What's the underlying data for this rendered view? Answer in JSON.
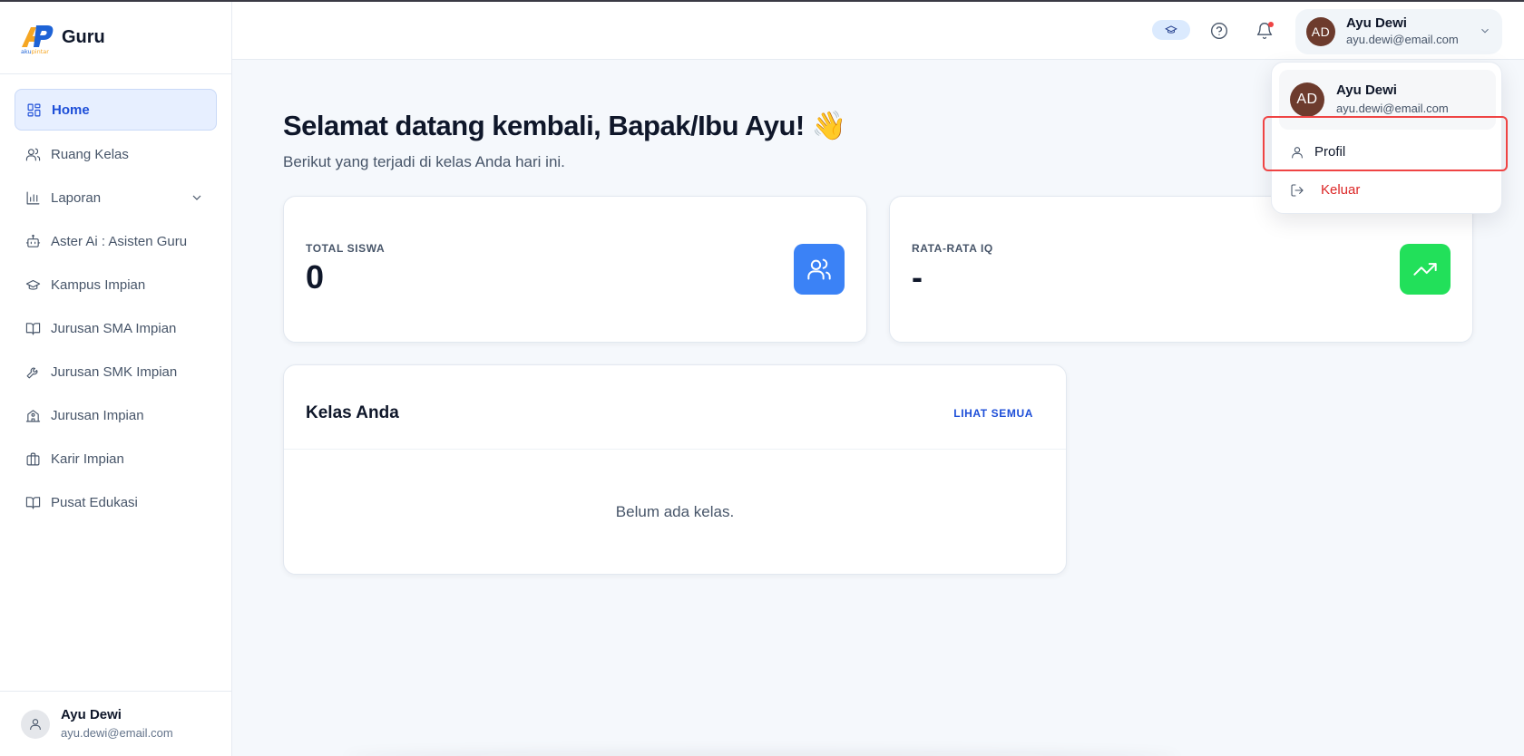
{
  "brand": {
    "name": "Guru",
    "logo_text": "akupintar"
  },
  "sidebar": {
    "items": [
      {
        "label": "Home",
        "icon": "dashboard-icon"
      },
      {
        "label": "Ruang Kelas",
        "icon": "users-icon"
      },
      {
        "label": "Laporan",
        "icon": "bar-chart-icon"
      },
      {
        "label": "Aster Ai : Asisten Guru",
        "icon": "bot-icon"
      },
      {
        "label": "Kampus Impian",
        "icon": "graduation-cap-icon"
      },
      {
        "label": "Jurusan SMA Impian",
        "icon": "book-open-icon"
      },
      {
        "label": "Jurusan SMK Impian",
        "icon": "wrench-icon"
      },
      {
        "label": "Jurusan Impian",
        "icon": "school-icon"
      },
      {
        "label": "Karir Impian",
        "icon": "briefcase-icon"
      },
      {
        "label": "Pusat Edukasi",
        "icon": "book-icon"
      }
    ],
    "user": {
      "name": "Ayu Dewi",
      "email": "ayu.dewi@email.com"
    }
  },
  "topbar": {
    "user": {
      "initials": "AD",
      "name": "Ayu Dewi",
      "email": "ayu.dewi@email.com"
    }
  },
  "main": {
    "welcome": "Selamat datang kembali, Bapak/Ibu Ayu! 👋",
    "subtitle": "Berikut yang terjadi di kelas Anda hari ini.",
    "stats": [
      {
        "label": "TOTAL SISWA",
        "value": "0",
        "color": "#3b82f6"
      },
      {
        "label": "RATA-RATA IQ",
        "value": "-",
        "color": "#22e05a"
      }
    ],
    "kelas": {
      "title": "Kelas Anda",
      "link": "LIHAT SEMUA",
      "empty": "Belum ada kelas."
    }
  },
  "dropdown": {
    "user": {
      "initials": "AD",
      "name": "Ayu Dewi",
      "email": "ayu.dewi@email.com"
    },
    "profil": "Profil",
    "keluar": "Keluar"
  },
  "colors": {
    "accent": "#1d4ed8",
    "danger": "#dc2626",
    "avatar": "#6d3b2d"
  }
}
